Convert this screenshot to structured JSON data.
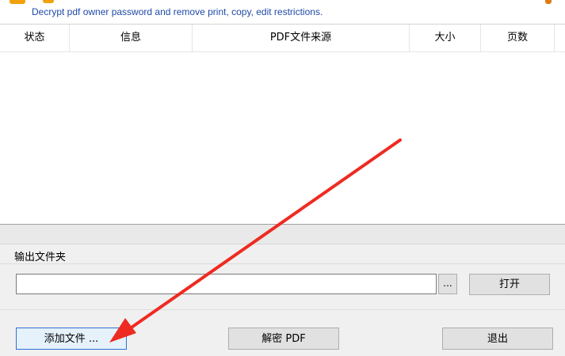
{
  "banner": {
    "subtitle": "Decrypt pdf owner password and remove print, copy, edit  restrictions."
  },
  "file_list": {
    "columns": [
      "状态",
      "信息",
      "PDF文件来源",
      "大小",
      "页数"
    ],
    "rows": []
  },
  "output": {
    "label": "输出文件夹",
    "path_value": "",
    "browse_label": "...",
    "open_label": "打开"
  },
  "actions": {
    "add_label": "添加文件 ...",
    "decrypt_label": "解密 PDF",
    "exit_label": "退出"
  },
  "annotation": {
    "arrow_color": "#ee2b22"
  }
}
